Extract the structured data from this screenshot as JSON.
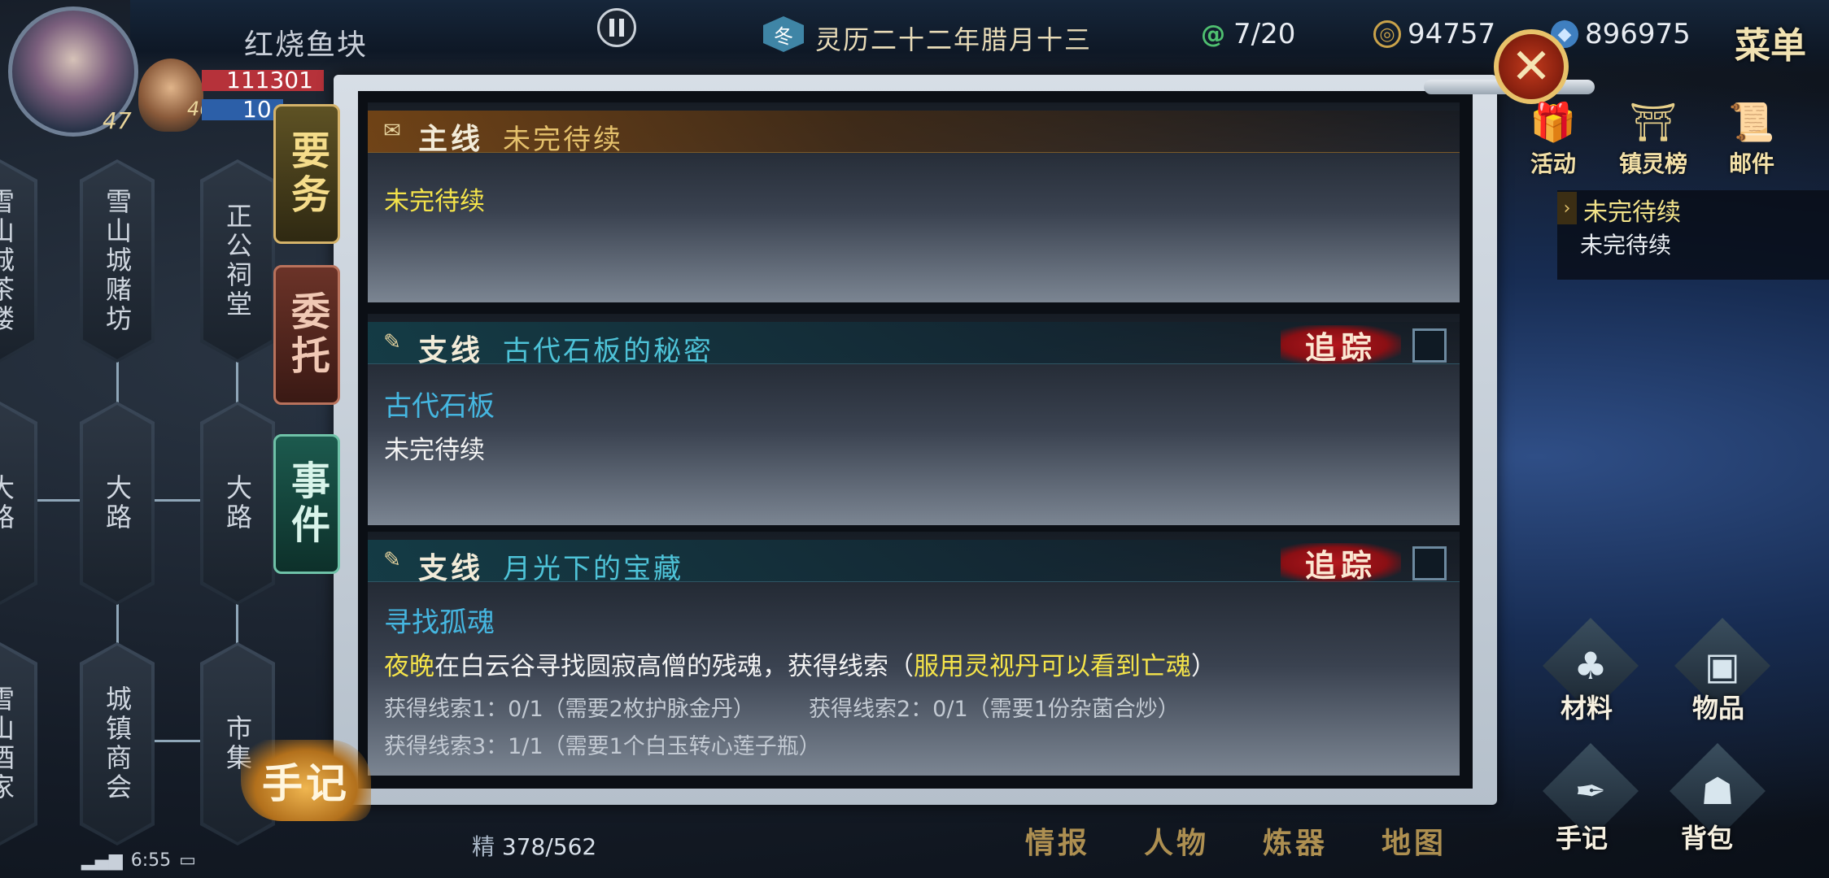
{
  "hud": {
    "player_name": "红烧鱼块",
    "hp": "111301",
    "mp": "10",
    "level_main": "47",
    "level_companion": "46",
    "date": "灵历二十二年腊月十三",
    "season": "冬",
    "energy": "7/20",
    "copper": "94757",
    "spirit_stones": "896975",
    "menu_label": "菜单",
    "stamina_label": "精",
    "stamina_value": "378/562"
  },
  "map": {
    "nodes": [
      "雪山城茶楼",
      "雪山城赌坊",
      "正公祠堂",
      "大路",
      "大路",
      "大路",
      "雪山酒家",
      "城镇商会",
      "市集"
    ]
  },
  "tabs": {
    "yaowu": "要务",
    "weituo": "委托",
    "shijian": "事件",
    "shouji": "手记"
  },
  "quests": [
    {
      "type": "主线",
      "title": "未完待续",
      "body": "未完待续"
    },
    {
      "type": "支线",
      "title": "古代石板的秘密",
      "track_label": "追踪",
      "subtitle": "古代石板",
      "body": "未完待续"
    },
    {
      "type": "支线",
      "title": "月光下的宝藏",
      "track_label": "追踪",
      "subtitle": "寻找孤魂",
      "desc_highlight_1": "夜晚",
      "desc_mid": "在白云谷寻找圆寂高僧的残魂，获得线索（",
      "desc_highlight_2": "服用灵视丹可以看到亡魂",
      "desc_end": "）",
      "clue_1": "获得线索1：0/1（需要2枚护脉金丹）",
      "clue_2": "获得线索2：0/1（需要1份杂菌合炒）",
      "clue_3": "获得线索3：1/1（需要1个白玉转心莲子瓶）"
    }
  ],
  "right_panel": {
    "top_icons": [
      "活动",
      "镇灵榜",
      "邮件"
    ],
    "tracked_title": "未完待续",
    "tracked_desc": "未完待续",
    "materials": "材料",
    "items": "物品",
    "journal": "手记",
    "backpack": "背包"
  },
  "bottom_nav": [
    "情报",
    "人物",
    "炼器",
    "地图"
  ],
  "status_bar": {
    "time": "6:55"
  },
  "colors": {
    "main_quest_title": "#e5c16c",
    "side_quest_title": "#4ec3d8",
    "track_red": "#b3171d",
    "highlight_yellow": "#f4e34a"
  }
}
